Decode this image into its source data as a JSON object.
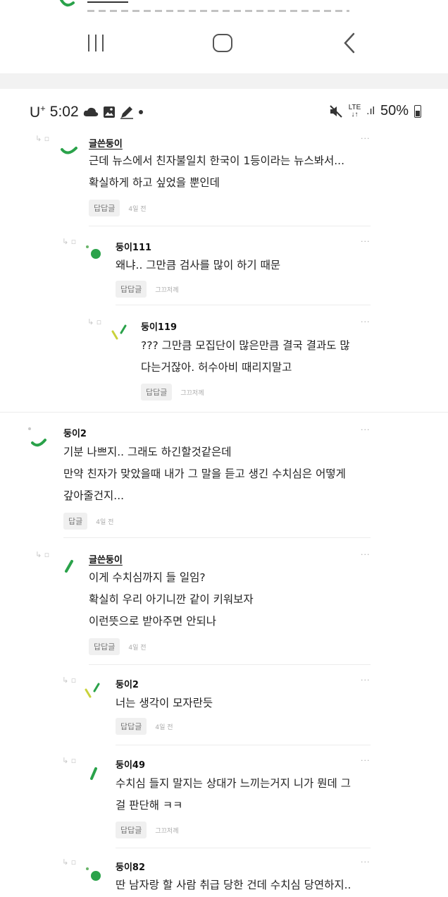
{
  "status_bar": {
    "carrier": "U",
    "carrier_sup": "+",
    "time": "5:02",
    "lte_top": "LTE",
    "lte_bottom": "↓↑",
    "signal": ".ıl",
    "battery": "50%"
  },
  "common": {
    "reply_label": "답답글",
    "more": "···"
  },
  "comments": [
    {
      "name": "글쓴둥이",
      "is_writer": true,
      "lines": [
        "근데 뉴스에서 친자불일치 한국이 1등이라는 뉴스봐서...",
        "확실하게 하고 싶었을 뿐인데"
      ],
      "reply_label": "답답글",
      "time": "4일 전"
    },
    {
      "name": "둥이111",
      "lines": [
        "왜냐.. 그만큼 검사를 많이 하기 때문"
      ],
      "reply_label": "답답글",
      "time": "그끄저께"
    },
    {
      "name": "둥이119",
      "lines": [
        "??? 그만큼 모집단이 많은만큼 결국 결과도 많",
        "다는거잖아. 허수아비 때리지말고"
      ],
      "reply_label": "답답글",
      "time": "그끄저께"
    },
    {
      "name": "둥이2",
      "lines": [
        "기분 나쁘지.. 그래도 하긴할것같은데",
        "만약 친자가 맞았을때 내가 그 말을 듣고 생긴 수치심은 어떻게",
        "갚아줄건지..."
      ],
      "reply_label": "답글",
      "time": "4일 전"
    },
    {
      "name": "글쓴둥이",
      "is_writer": true,
      "lines": [
        "이게 수치심까지 들 일임?",
        "확실히 우리 아기니깐 같이 키워보자",
        "이런뜻으로 받아주면 안되나"
      ],
      "reply_label": "답답글",
      "time": "4일 전"
    },
    {
      "name": "둥이2",
      "lines": [
        "너는 생각이 모자란듯"
      ],
      "reply_label": "답답글",
      "time": "4일 전"
    },
    {
      "name": "둥이49",
      "lines": [
        "수치심 들지 말지는 상대가 느끼는거지 니가 뭔데 그",
        "걸 판단해 ㅋㅋ"
      ],
      "reply_label": "답답글",
      "time": "그끄저께"
    },
    {
      "name": "둥이82",
      "lines": [
        "딴 남자랑 할 사람 취급 당한 건데 수치심 당연하지.."
      ]
    }
  ]
}
